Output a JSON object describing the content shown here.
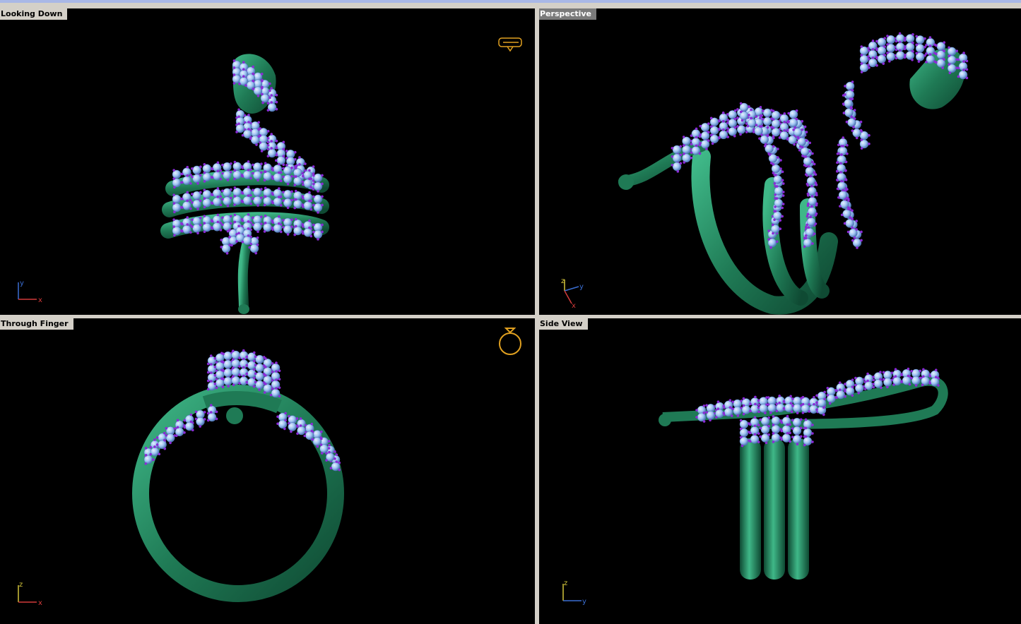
{
  "viewports": [
    {
      "id": "top-left",
      "label": "Looking Down",
      "axes": [
        "y",
        "x"
      ]
    },
    {
      "id": "top-right",
      "label": "Perspective",
      "axes": [
        "z",
        "y",
        "x"
      ]
    },
    {
      "id": "bottom-left",
      "label": "Through Finger",
      "axes": [
        "z",
        "x"
      ]
    },
    {
      "id": "bottom-right",
      "label": "Side View",
      "axes": [
        "z",
        "y"
      ]
    }
  ],
  "colors": {
    "background": "#000000",
    "metal": "#1f7a55",
    "metal_highlight": "#3fb888",
    "stone": "#9fc4f2",
    "prong": "#8a2bd6",
    "axis_x": "#d23a3a",
    "axis_y": "#3a6ed2",
    "axis_z": "#d2c43a",
    "widget": "#e0a020"
  }
}
